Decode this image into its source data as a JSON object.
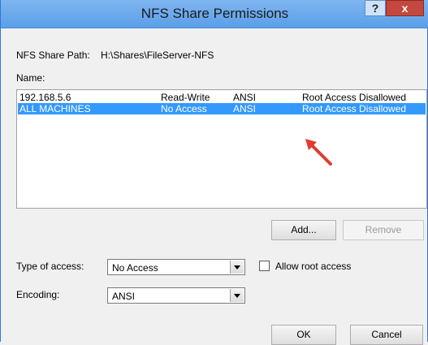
{
  "window": {
    "title": "NFS Share Permissions",
    "help_label": "?",
    "close_label": "x"
  },
  "share_path": {
    "label": "NFS Share Path:",
    "value": "H:\\Shares\\FileServer-NFS"
  },
  "name_label": "Name:",
  "permissions": {
    "rows": [
      {
        "host": "192.168.5.6",
        "access": "Read-Write",
        "encoding": "ANSI",
        "root": "Root Access Disallowed",
        "selected": false
      },
      {
        "host": "ALL MACHINES",
        "access": "No Access",
        "encoding": "ANSI",
        "root": "Root Access Disallowed",
        "selected": true
      }
    ]
  },
  "buttons": {
    "add": "Add...",
    "remove": "Remove",
    "ok": "OK",
    "cancel": "Cancel"
  },
  "type_of_access": {
    "label": "Type of access:",
    "value": "No Access"
  },
  "allow_root": {
    "label": "Allow root access",
    "checked": false
  },
  "encoding": {
    "label": "Encoding:",
    "value": "ANSI"
  },
  "colors": {
    "title_bar": "#5a9ee8",
    "selection": "#3399ff",
    "close_button": "#c4483e",
    "annotation_arrow": "#e03c32"
  },
  "icons": {
    "annotation": "red-arrow-icon"
  }
}
